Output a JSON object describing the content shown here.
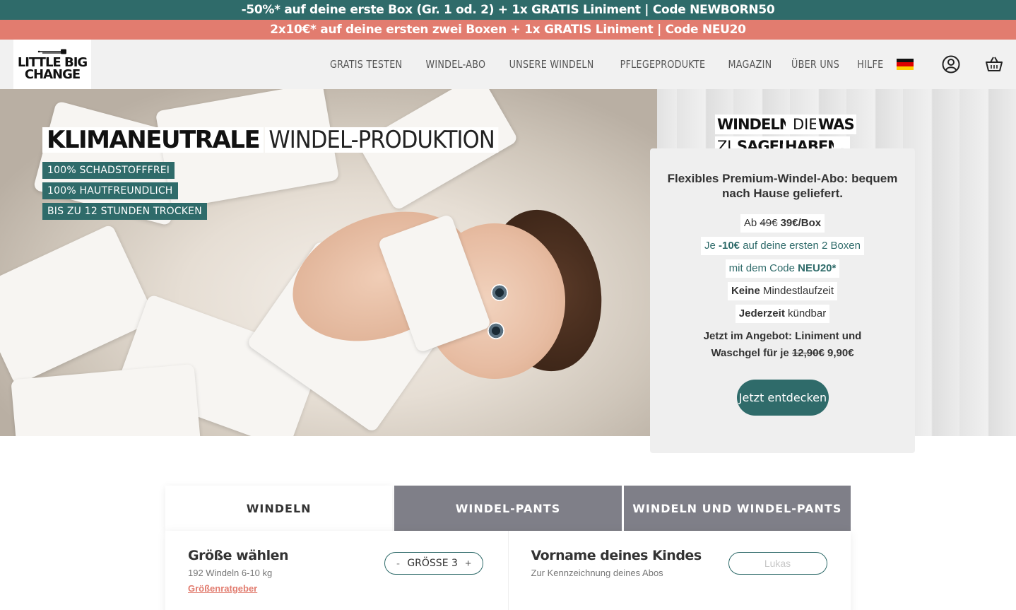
{
  "promo": {
    "line1": "-50%* auf deine erste Box (Gr. 1 od. 2) + 1x GRATIS Liniment | Code NEWBORN50",
    "line2": "2x10€* auf deine ersten zwei Boxen + 1x GRATIS Liniment | Code NEU20"
  },
  "logo": {
    "line1": "LITTLE BIG",
    "line2": "CHANGE"
  },
  "nav": {
    "items": [
      "GRATIS TESTEN",
      "WINDEL-ABO",
      "UNSERE WINDELN",
      "PFLEGEPRODUKTE",
      "MAGAZIN",
      "ÜBER UNS",
      "HILFE"
    ],
    "language": "de-flag-icon",
    "account_icon": "user-icon",
    "cart_icon": "basket-icon"
  },
  "hero": {
    "title_bold": "KLIMANEUTRALE",
    "title_light": "WINDEL-PRODUKTION",
    "badges": [
      "100% SCHADSTOFFFREI",
      "100% HAUTFREUNDLICH",
      "BIS ZU 12 STUNDEN TROCKEN"
    ],
    "tagline": [
      "WINDELN",
      "DIE",
      "WAS",
      "ZU",
      "SAGEN",
      "HABEN",
      "."
    ]
  },
  "offer": {
    "heading": "Flexibles Premium-Windel-Abo: bequem nach Hause geliefert.",
    "price_prefix": "Ab",
    "price_old": "49€",
    "price_new": "39€/Box",
    "discount_prefix": "Je",
    "discount_value": "-10€",
    "discount_suffix": "auf deine ersten 2 Boxen",
    "code_prefix": "mit dem Code",
    "code_value": "NEU20*",
    "term_bold": "Keine",
    "term_rest": "Mindestlaufzeit",
    "cancel_bold": "Jederzeit",
    "cancel_rest": "kündbar",
    "note_prefix": "Jetzt im Angebot: Liniment und Waschgel für je",
    "note_old": "12,90€",
    "note_new": "9,90€",
    "cta": "Jetzt entdecken"
  },
  "tabs": [
    "WINDELN",
    "WINDEL-PANTS",
    "WINDELN UND WINDEL-PANTS"
  ],
  "size": {
    "title": "Größe wählen",
    "subtitle": "192 Windeln 6-10 kg",
    "guide": "Größenratgeber",
    "minus": "-",
    "value": "GRÖSSE 3",
    "plus": "+"
  },
  "child": {
    "title": "Vorname deines Kindes",
    "subtitle": "Zur Kennzeichnung deines Abos",
    "placeholder": "Lukas"
  },
  "colors": {
    "teal": "#2f6b6a",
    "coral": "#e27c6f",
    "tab_gray": "#7f7f88"
  }
}
